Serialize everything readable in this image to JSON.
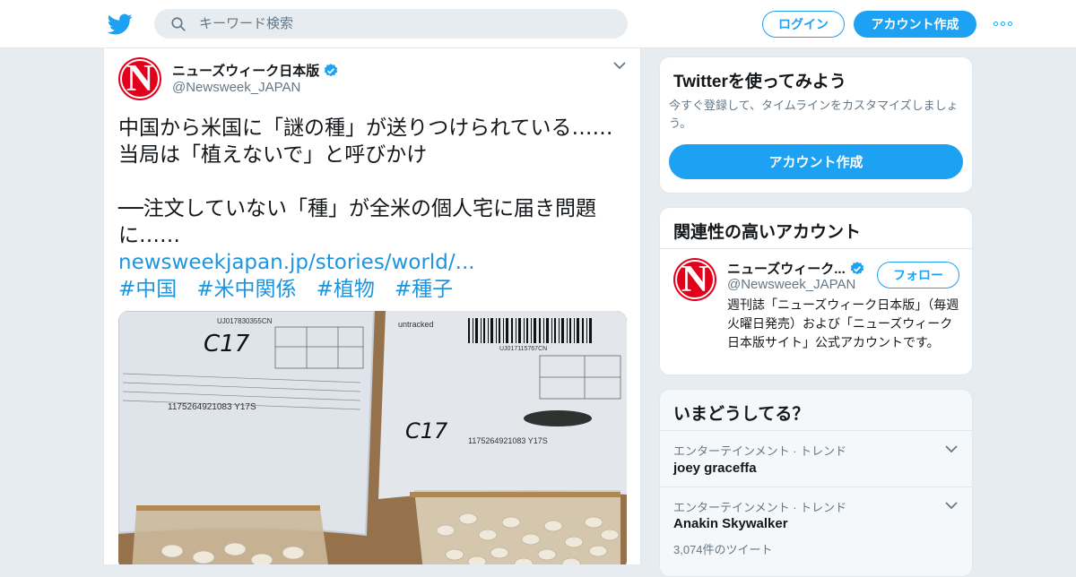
{
  "header": {
    "search_placeholder": "キーワード検索",
    "login_label": "ログイン",
    "signup_label": "アカウント作成"
  },
  "tweet": {
    "avatar_letter": "N",
    "display_name": "ニューズウィーク日本版",
    "handle": "@Newsweek_JAPAN",
    "text_line1": "中国から米国に「謎の種」が送りつけられている……",
    "text_line2": "当局は「植えないで」と呼びかけ",
    "text_line3": "──注文していない「種」が全米の個人宅に届き問題",
    "text_line4": "に……",
    "link": "newsweekjapan.jp/stories/world/...",
    "hashtags": [
      "#中国",
      "#米中関係",
      "#植物",
      "#種子"
    ],
    "media": {
      "left_tracking": "UJ017830355CN",
      "right_tracking": "UJ017115767CN",
      "barcode_text": "1175264921083 Y17S",
      "handwritten": "C17",
      "right_header": "untracked"
    }
  },
  "cta_card": {
    "title": "Twitterを使ってみよう",
    "subtitle": "今すぐ登録して、タイムラインをカスタマイズしましょう。",
    "button_label": "アカウント作成"
  },
  "relevant_accounts": {
    "title": "関連性の高いアカウント",
    "account": {
      "avatar_letter": "N",
      "name": "ニューズウィーク...",
      "handle": "@Newsweek_JAPAN",
      "follow_label": "フォロー",
      "bio": "週刊誌「ニューズウィーク日本版」（毎週火曜日発売）および「ニューズウィーク日本版サイト」公式アカウントです。"
    }
  },
  "trends": {
    "title": "いまどうしてる？",
    "items": [
      {
        "category": "エンターテインメント · トレンド",
        "name": "joey graceffa",
        "count": ""
      },
      {
        "category": "エンターテインメント · トレンド",
        "name": "Anakin Skywalker",
        "count": "3,074件のツイート"
      }
    ]
  },
  "colors": {
    "brand": "#1da1f2",
    "link": "#1b95e0",
    "newsweek_red": "#e2001a",
    "background": "#e6ecf0"
  },
  "icons": [
    "twitter-bird-icon",
    "search-icon",
    "more-dots-icon",
    "verified-badge-icon",
    "chevron-down-icon"
  ]
}
